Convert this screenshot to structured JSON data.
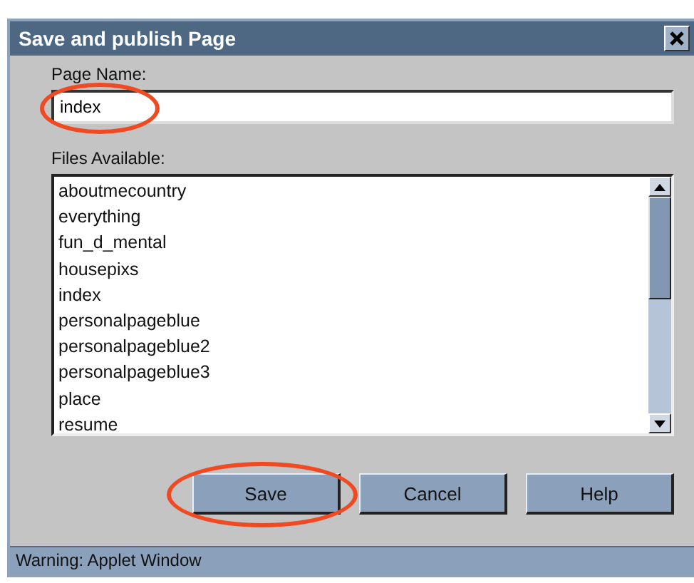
{
  "window": {
    "title": "Save and publish Page"
  },
  "page_name": {
    "label": "Page Name:",
    "value": "index",
    "circled": true
  },
  "files": {
    "label": "Files Available:",
    "items": [
      {
        "name": "aboutmecountry",
        "selected": false
      },
      {
        "name": "everything",
        "selected": false
      },
      {
        "name": "fun_d_mental",
        "selected": false
      },
      {
        "name": "housepixs",
        "selected": false
      },
      {
        "name": "index",
        "selected": false
      },
      {
        "name": "personalpageblue",
        "selected": false
      },
      {
        "name": "personalpageblue2",
        "selected": false
      },
      {
        "name": "personalpageblue3",
        "selected": false
      },
      {
        "name": "place",
        "selected": false
      },
      {
        "name": "resume",
        "selected": false
      }
    ]
  },
  "buttons": [
    {
      "label": "Save",
      "circled": true
    },
    {
      "label": "Cancel",
      "circled": false
    },
    {
      "label": "Help",
      "circled": false
    }
  ],
  "status_bar": "Warning: Applet Window"
}
